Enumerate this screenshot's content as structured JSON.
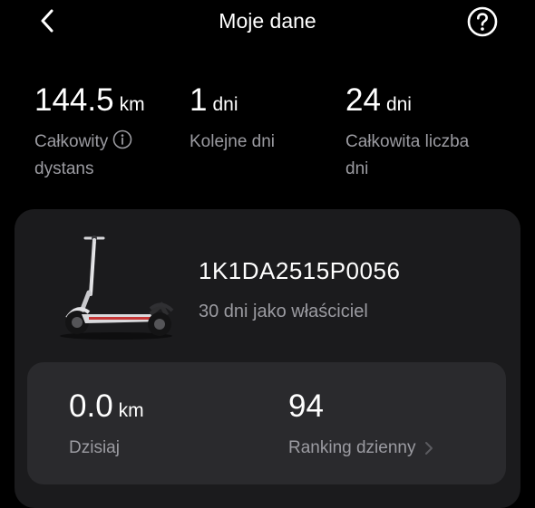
{
  "header": {
    "title": "Moje dane",
    "back_icon": "chevron-left-icon",
    "help_icon": "question-circle-icon"
  },
  "stats": [
    {
      "value": "144.5",
      "unit": "km",
      "label_line1": "Całkowity",
      "label_line2": "dystans",
      "has_info_icon": true
    },
    {
      "value": "1",
      "unit": "dni",
      "label_line1": "Kolejne dni",
      "label_line2": ""
    },
    {
      "value": "24",
      "unit": "dni",
      "label_line1": "Całkowita liczba",
      "label_line2": "dni"
    }
  ],
  "vehicle": {
    "serial": "1K1DA2515P0056",
    "owner_days": "30 dni jako właściciel",
    "image_icon": "scooter-icon"
  },
  "today": {
    "distance_value": "0.0",
    "distance_unit": "km",
    "distance_label": "Dzisiaj",
    "ranking_value": "94",
    "ranking_label": "Ranking dzienny"
  },
  "colors": {
    "background": "#000000",
    "card": "#1b1b1d",
    "inner_card": "#2a2a2d",
    "secondary_text": "#9b9ba1"
  }
}
